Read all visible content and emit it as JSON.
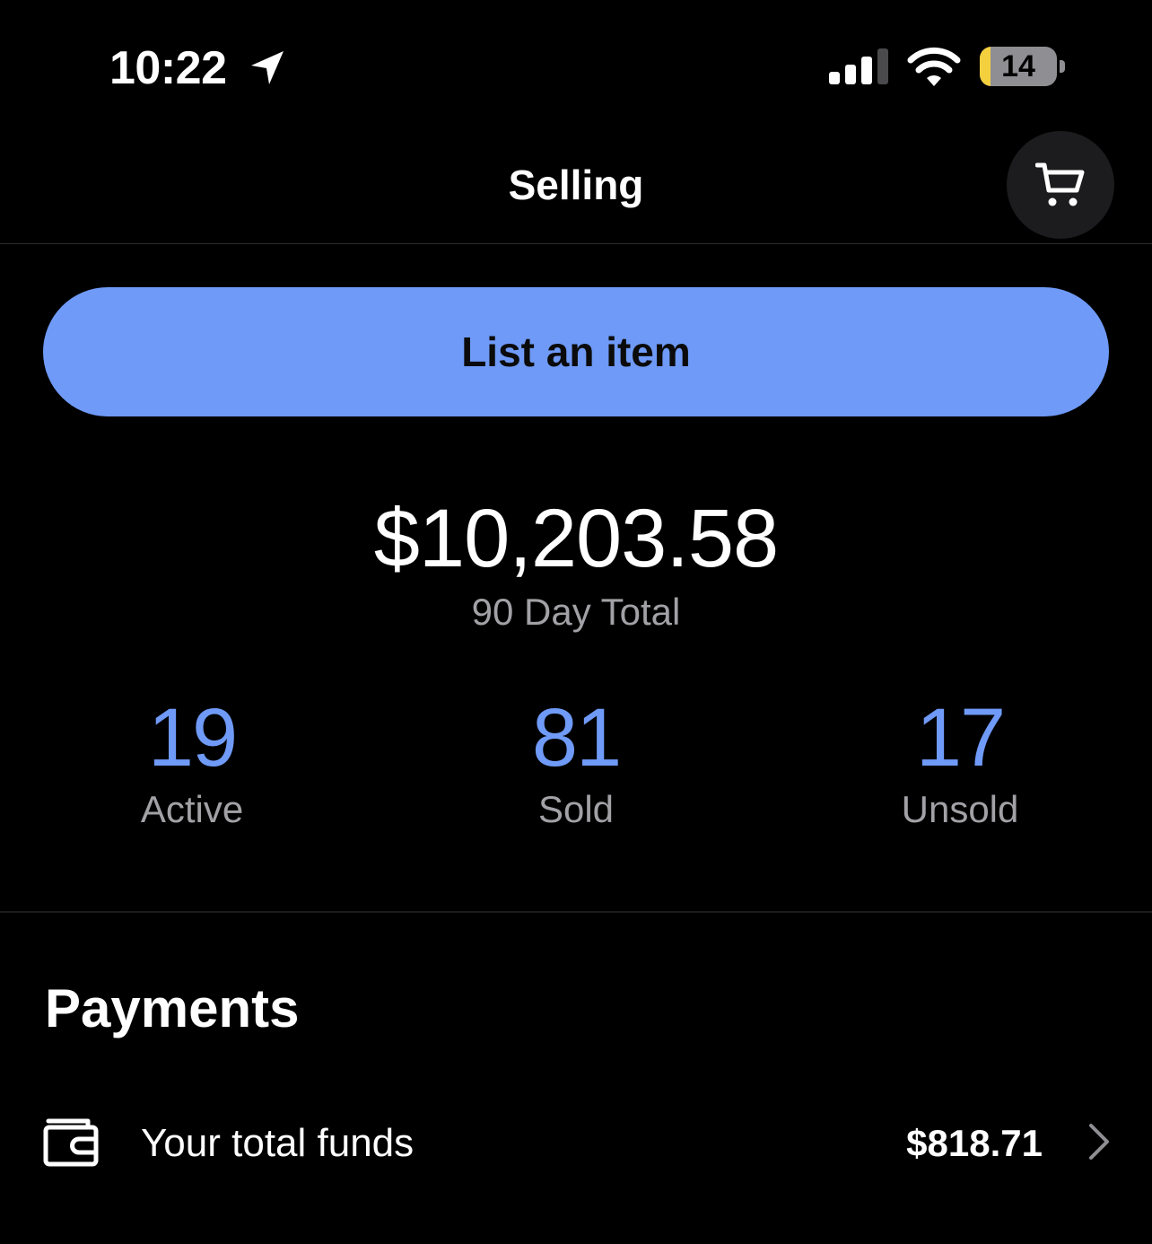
{
  "status_bar": {
    "time": "10:22",
    "battery_level": "14",
    "battery_fraction": 0.14
  },
  "header": {
    "title": "Selling"
  },
  "actions": {
    "list_item_label": "List an item"
  },
  "summary": {
    "total_amount": "$10,203.58",
    "total_caption": "90 Day Total"
  },
  "stats": [
    {
      "value": "19",
      "label": "Active"
    },
    {
      "value": "81",
      "label": "Sold"
    },
    {
      "value": "17",
      "label": "Unsold"
    }
  ],
  "payments": {
    "heading": "Payments",
    "funds_label": "Your total funds",
    "funds_amount": "$818.71"
  },
  "colors": {
    "accent": "#6f9af7",
    "background": "#000000",
    "secondary_text": "#a1a1a6",
    "battery_low": "#f4d03f"
  },
  "icons": [
    "location-arrow-icon",
    "cellular-signal-icon",
    "wifi-icon",
    "battery-icon",
    "cart-icon",
    "wallet-icon",
    "chevron-right-icon"
  ]
}
